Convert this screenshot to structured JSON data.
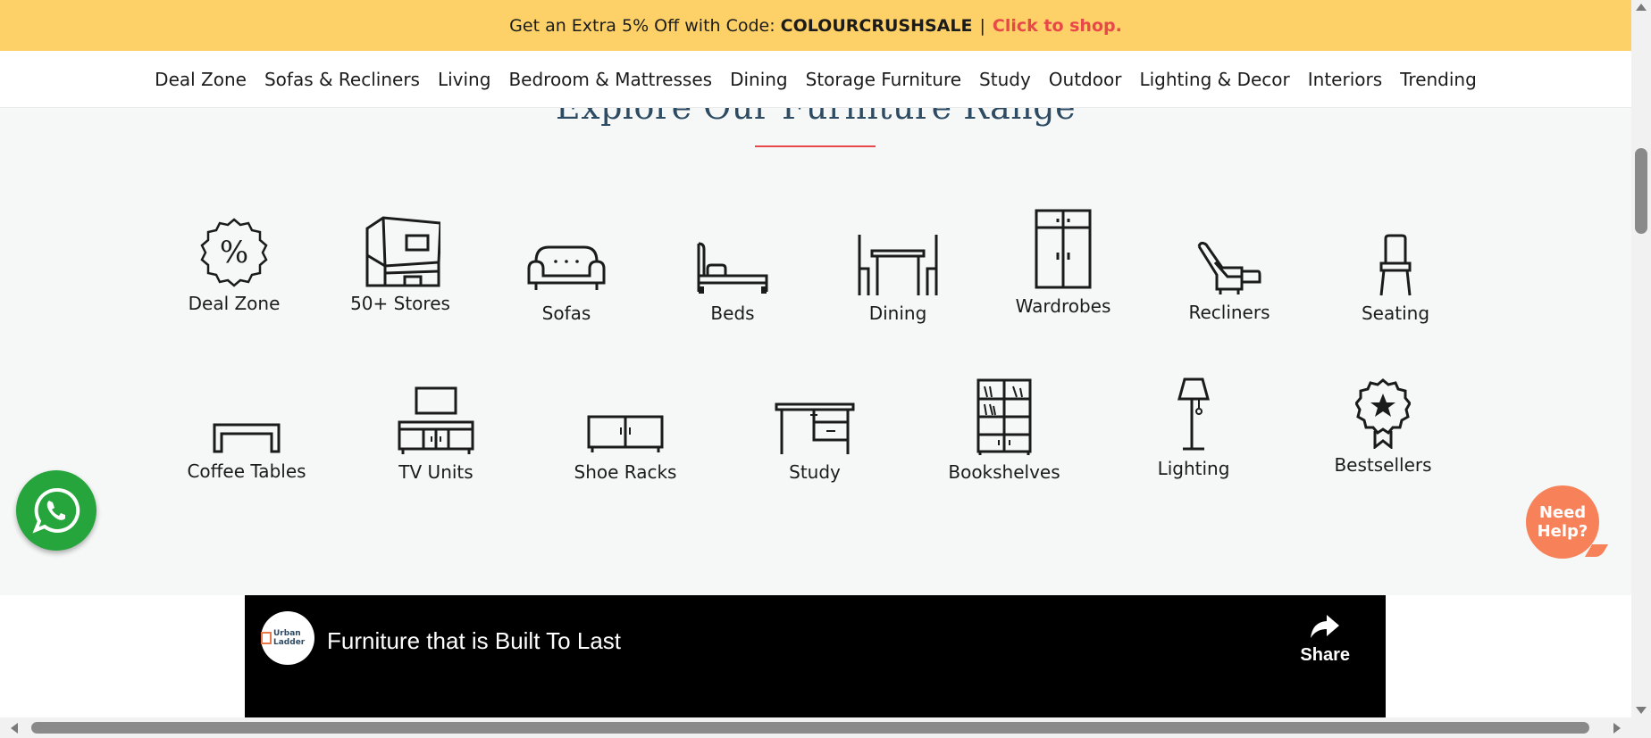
{
  "promo": {
    "text": "Get an Extra 5% Off with Code:",
    "code": "COLOURCRUSHSALE",
    "separator": "|",
    "cta": "Click to shop.",
    "bg_color": "#fdd167",
    "cta_color": "#e9484b"
  },
  "nav": {
    "items": [
      {
        "label": "Deal Zone"
      },
      {
        "label": "Sofas & Recliners"
      },
      {
        "label": "Living"
      },
      {
        "label": "Bedroom & Mattresses"
      },
      {
        "label": "Dining"
      },
      {
        "label": "Storage Furniture"
      },
      {
        "label": "Study"
      },
      {
        "label": "Outdoor"
      },
      {
        "label": "Lighting & Decor"
      },
      {
        "label": "Interiors"
      },
      {
        "label": "Trending"
      }
    ]
  },
  "section": {
    "title": "Explore Our Furniture Range",
    "accent_color": "#e9484b"
  },
  "categories": [
    {
      "label": "Deal Zone",
      "icon": "deal-zone-icon"
    },
    {
      "label": "50+ Stores",
      "icon": "stores-icon"
    },
    {
      "label": "Sofas",
      "icon": "sofa-icon"
    },
    {
      "label": "Beds",
      "icon": "bed-icon"
    },
    {
      "label": "Dining",
      "icon": "dining-icon"
    },
    {
      "label": "Wardrobes",
      "icon": "wardrobe-icon"
    },
    {
      "label": "Recliners",
      "icon": "recliner-icon"
    },
    {
      "label": "Seating",
      "icon": "chair-icon"
    },
    {
      "label": "Coffee Tables",
      "icon": "coffee-table-icon"
    },
    {
      "label": "TV Units",
      "icon": "tv-unit-icon"
    },
    {
      "label": "Shoe Racks",
      "icon": "shoe-rack-icon"
    },
    {
      "label": "Study",
      "icon": "study-desk-icon"
    },
    {
      "label": "Bookshelves",
      "icon": "bookshelf-icon"
    },
    {
      "label": "Lighting",
      "icon": "floor-lamp-icon"
    },
    {
      "label": "Bestsellers",
      "icon": "bestseller-badge-icon"
    }
  ],
  "video": {
    "title": "Furniture that is Built To Last",
    "channel_logo_text": "Urban Ladder",
    "share_label": "Share"
  },
  "widgets": {
    "whatsapp_icon": "whatsapp-icon",
    "whatsapp_color": "#25a53b",
    "help_label": "Need Help?",
    "help_color": "#f7825a"
  }
}
